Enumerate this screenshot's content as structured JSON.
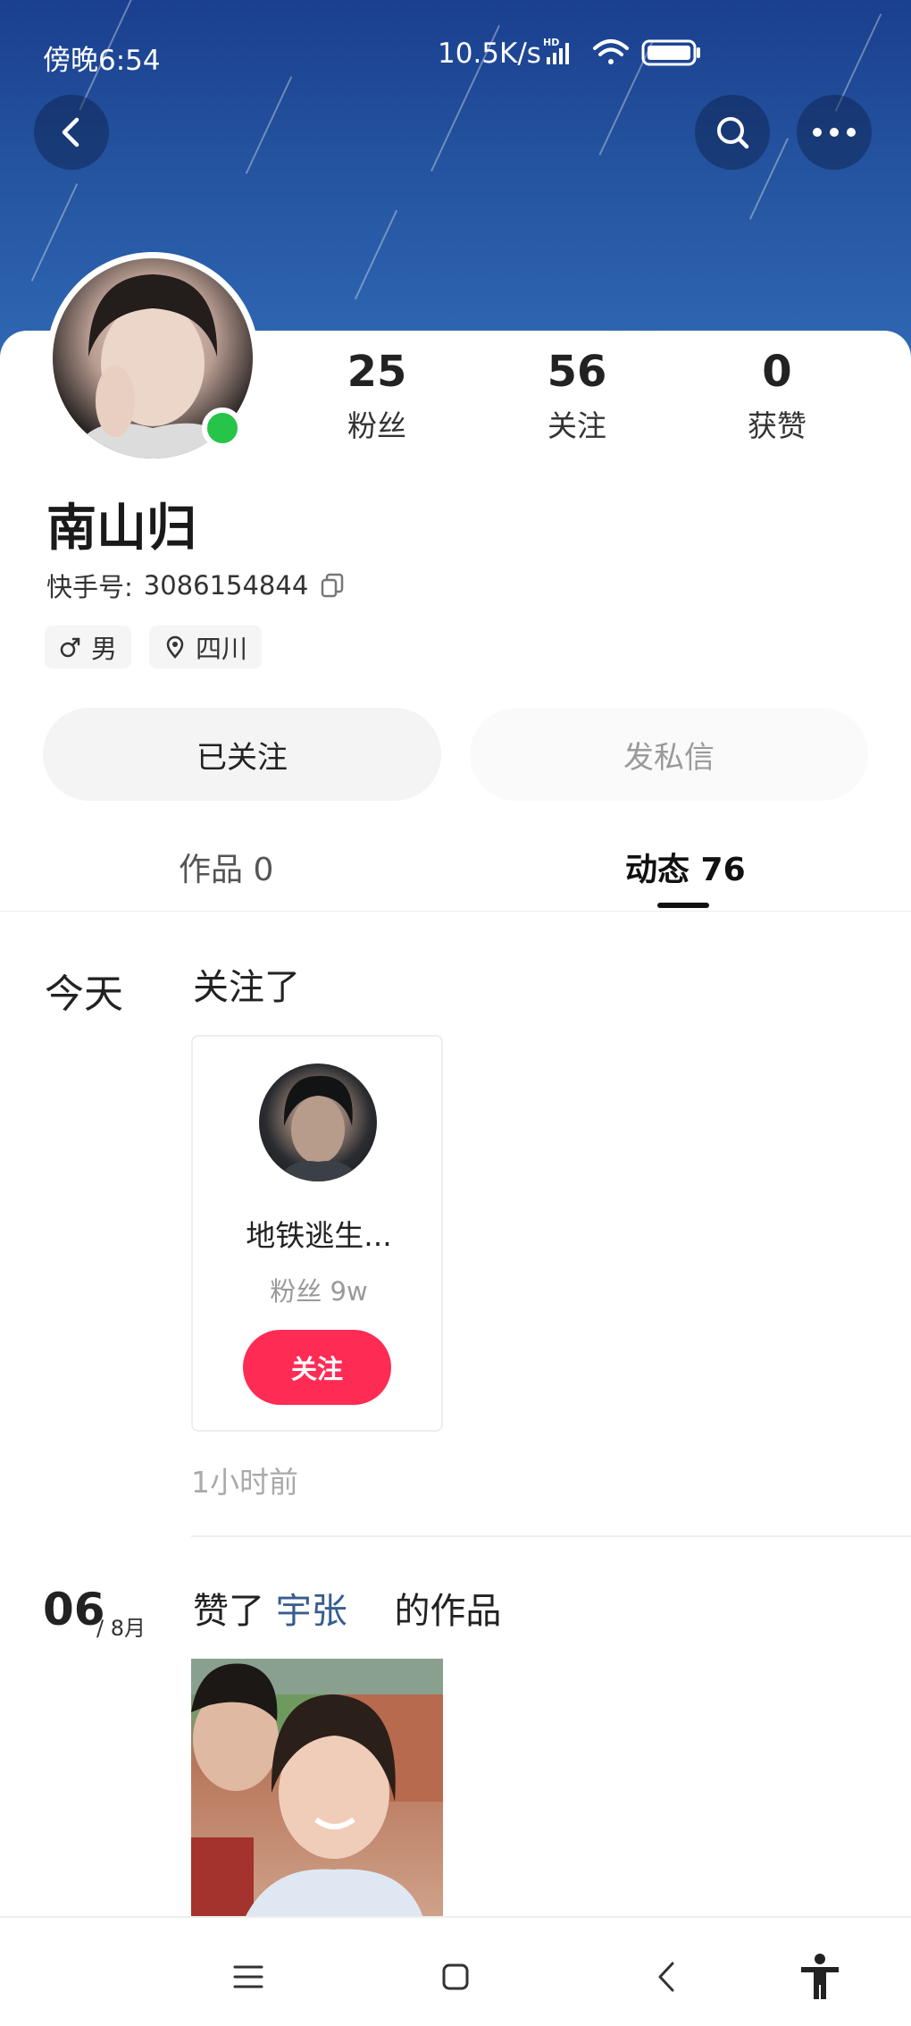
{
  "status_bar": {
    "time": "傍晚6:54",
    "network_speed": "10.5K/s",
    "icons": [
      "hd-signal-icon",
      "wifi-icon",
      "battery-icon"
    ]
  },
  "header": {
    "back_icon": "back-icon",
    "search_icon": "search-icon",
    "more_icon": "more-icon"
  },
  "profile": {
    "name": "南山归",
    "kuaishou_id_label": "快手号:",
    "kuaishou_id": "3086154844",
    "online": true,
    "tags": [
      {
        "icon": "male-icon",
        "label": "男"
      },
      {
        "icon": "location-icon",
        "label": "四川"
      }
    ],
    "stats": [
      {
        "value": "25",
        "label": "粉丝"
      },
      {
        "value": "56",
        "label": "关注"
      },
      {
        "value": "0",
        "label": "获赞"
      }
    ]
  },
  "actions": {
    "followed_label": "已关注",
    "message_label": "发私信"
  },
  "tabs": [
    {
      "label": "作品 0",
      "active": false
    },
    {
      "label": "动态 76",
      "active": true
    }
  ],
  "feed": [
    {
      "day": "今天",
      "action": "关注了",
      "card": {
        "name": "地铁逃生...",
        "fans": "粉丝 9w",
        "follow_label": "关注"
      },
      "time_ago": "1小时前"
    },
    {
      "day_num": "06",
      "month": "/ 8月",
      "action_prefix": "赞了",
      "user": "宇张",
      "action_suffix": "的作品"
    }
  ],
  "nav": [
    "menu-icon",
    "home-square-icon",
    "back-nav-icon",
    "accessibility-icon"
  ],
  "colors": {
    "accent": "#fe2c55",
    "online": "#27c44a",
    "link": "#385d8f",
    "banner": "#24539f"
  }
}
